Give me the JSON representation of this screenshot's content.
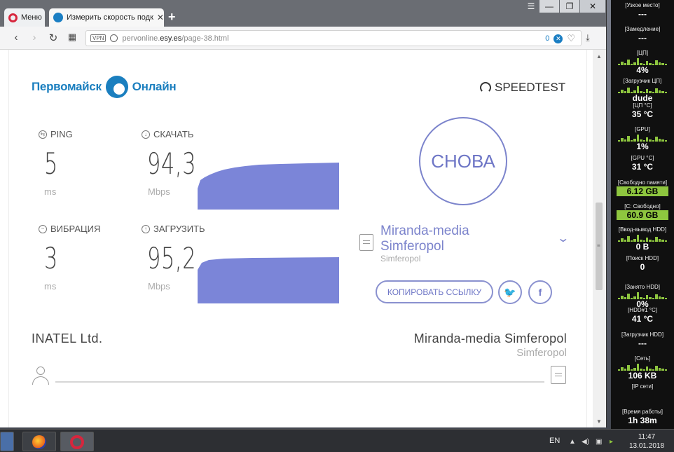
{
  "browser": {
    "menu_tab": "Меню",
    "active_tab": "Измерить скорость подк",
    "new_tab": "+",
    "url_host": "pervonline.",
    "url_domain": "esy.es",
    "url_path": "/page-38.html",
    "vpn": "VPN",
    "adblock_count": "0"
  },
  "page": {
    "logo_left": "Первомайск",
    "logo_right": "Онлайн",
    "speedtest": "SPEEDTEST",
    "ping_label": "PING",
    "ping_value": "5",
    "ping_unit": "ms",
    "jitter_label": "ВИБРАЦИЯ",
    "jitter_value": "3",
    "jitter_unit": "ms",
    "download_label": "СКАЧАТЬ",
    "download_value": "94,3",
    "download_unit": "Mbps",
    "upload_label": "ЗАГРУЗИТЬ",
    "upload_value": "95,2",
    "upload_unit": "Mbps",
    "again": "СНОВА",
    "server_name": "Miranda-media Simferopol",
    "server_city": "Simferopol",
    "copy_link": "КОПИРОВАТЬ ССЫЛКУ",
    "isp": "INATEL Ltd.",
    "server_bottom": "Miranda-media Simferopol",
    "server_bottom_city": "Simferopol"
  },
  "gadget": [
    {
      "label": "[Узкое место]",
      "value": "---"
    },
    {
      "label": "[Замедление]",
      "value": "---"
    },
    {
      "label": "[ЦП]",
      "value": "4%"
    },
    {
      "label": "[Загрузчик ЦП]",
      "value": "dude"
    },
    {
      "label": "[ЦП °C]",
      "value": "35 °C"
    },
    {
      "label": "[GPU]",
      "value": "1%"
    },
    {
      "label": "[GPU °C]",
      "value": "31 °C"
    },
    {
      "label": "[Свободно памяти]",
      "value": "6.12 GB"
    },
    {
      "label": "[C: Свободно]",
      "value": "60.9 GB"
    },
    {
      "label": "[Ввод-вывод HDD]",
      "value": "0 B"
    },
    {
      "label": "[Поиск HDD]",
      "value": "0"
    },
    {
      "label": "[Занято HDD]",
      "value": "0%"
    },
    {
      "label": "[HDD#1 °C]",
      "value": "41 °C"
    },
    {
      "label": "[Загрузчик HDD]",
      "value": "---"
    },
    {
      "label": "[Сеть]",
      "value": "106 KB"
    },
    {
      "label": "[IP сети]",
      "value": ""
    },
    {
      "label": "[Время работы]",
      "value": "1h 38m"
    }
  ],
  "taskbar": {
    "lang": "EN",
    "time": "11:47",
    "date": "13.01.2018"
  }
}
